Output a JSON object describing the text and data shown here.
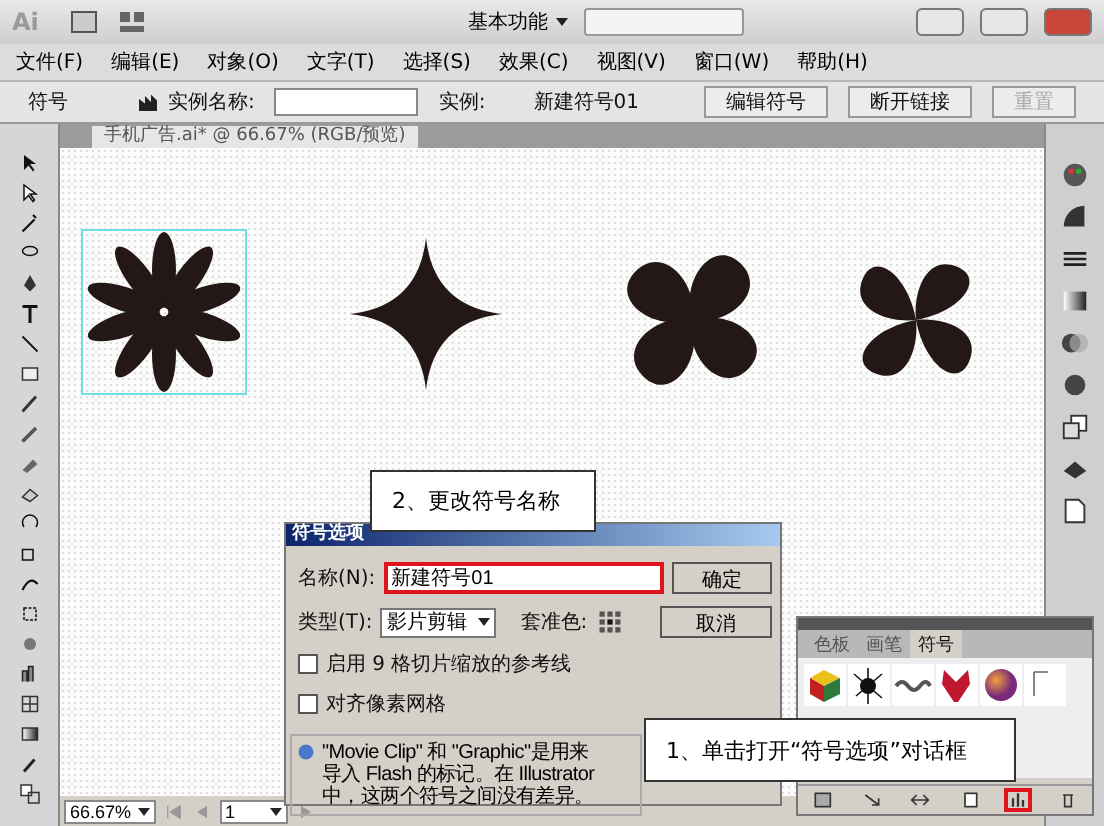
{
  "app_bar": {
    "logo": "Ai",
    "workspace": "基本功能"
  },
  "menu": [
    "文件(F)",
    "编辑(E)",
    "对象(O)",
    "文字(T)",
    "选择(S)",
    "效果(C)",
    "视图(V)",
    "窗口(W)",
    "帮助(H)"
  ],
  "control_bar": {
    "label": "符号",
    "instance_name_label": "实例名称:",
    "instance_label": "实例:",
    "instance_value": "新建符号01",
    "buttons": [
      {
        "label": "编辑符号",
        "disabled": false
      },
      {
        "label": "断开链接",
        "disabled": false
      },
      {
        "label": "重置",
        "disabled": true
      }
    ]
  },
  "document_tab": {
    "title": "手机广告.ai* @ 66.67% (RGB/预览)"
  },
  "dialog": {
    "title": "符号选项",
    "name_label": "名称(N):",
    "name_value": "新建符号01",
    "name_highlighted": true,
    "type_label": "类型(T):",
    "type_value": "影片剪辑",
    "registration_label": "套准色:",
    "buttons": [
      "确定",
      "取消"
    ],
    "checkboxes": [
      {
        "label": "启用 9 格切片缩放的参考线",
        "checked": false
      },
      {
        "label": "对齐像素网格",
        "checked": false
      }
    ],
    "info": [
      "\"Movie Clip\" 和 \"Graphic\"是用来",
      "导入 Flash 的标记。在 Illustrator",
      "中，这两个符号之间没有差异。"
    ]
  },
  "symbols_panel": {
    "tabs": [
      {
        "label": "色板",
        "selected": false
      },
      {
        "label": "画笔",
        "selected": false
      },
      {
        "label": "符号",
        "selected": true
      }
    ],
    "footer_buttons": [
      {
        "highlighted": false
      },
      {
        "highlighted": false
      },
      {
        "highlighted": false
      },
      {
        "highlighted": false
      },
      {
        "highlighted": true
      },
      {
        "highlighted": false
      }
    ]
  },
  "status_bar": {
    "zoom": "66.67%",
    "page": "1"
  },
  "callouts": [
    {
      "text": "2、更改符号名称"
    },
    {
      "text": "1、单击打开“符号选项”对话框"
    }
  ]
}
